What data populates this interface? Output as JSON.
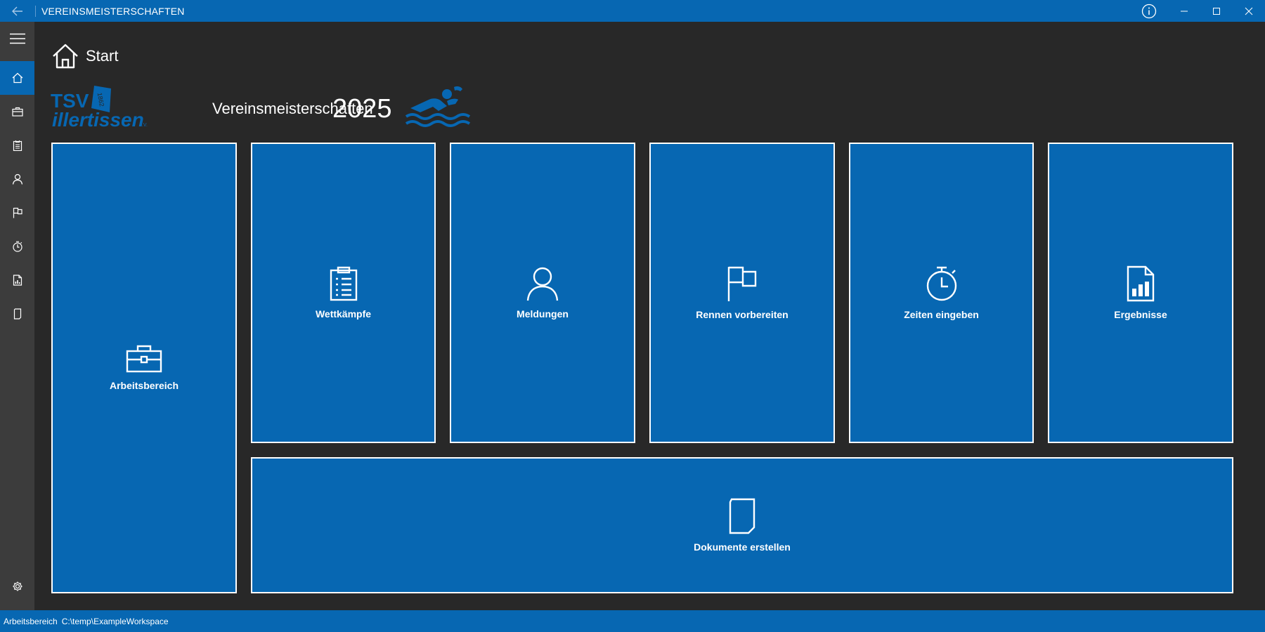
{
  "window": {
    "title": "VEREINSMEISTERSCHAFTEN",
    "back_icon": "back-arrow-icon",
    "info_icon": "info-icon",
    "minimize_icon": "minimize-icon",
    "maximize_icon": "maximize-icon",
    "close_icon": "close-icon"
  },
  "nav": {
    "items": [
      {
        "name": "hamburger-menu",
        "icon": "hamburger-icon"
      },
      {
        "name": "home",
        "icon": "home-icon",
        "active": true
      },
      {
        "name": "workspace",
        "icon": "briefcase-icon"
      },
      {
        "name": "competitions",
        "icon": "clipboard-icon"
      },
      {
        "name": "registrations",
        "icon": "person-icon"
      },
      {
        "name": "races",
        "icon": "flag-icon"
      },
      {
        "name": "times",
        "icon": "stopwatch-icon"
      },
      {
        "name": "results",
        "icon": "report-icon"
      },
      {
        "name": "documents",
        "icon": "document-icon"
      },
      {
        "name": "settings",
        "icon": "gear-icon"
      }
    ]
  },
  "header": {
    "title": "Start",
    "icon": "home-icon"
  },
  "brand": {
    "logo_text_line1": "TSV",
    "logo_text_line2": "illertissen",
    "logo_badge": "1862",
    "logo_suffix": "e.V.",
    "name": "Vereinsmeisterschaften",
    "year": "2025",
    "swimmer_icon": "swimmer-icon"
  },
  "tiles": {
    "workspace": {
      "label": "Arbeitsbereich",
      "icon": "briefcase-icon"
    },
    "competitions": {
      "label": "Wettkämpfe",
      "icon": "clipboard-icon"
    },
    "registrations": {
      "label": "Meldungen",
      "icon": "person-icon"
    },
    "prepare_races": {
      "label": "Rennen vorbereiten",
      "icon": "flag-icon"
    },
    "enter_times": {
      "label": "Zeiten eingeben",
      "icon": "stopwatch-icon"
    },
    "results": {
      "label": "Ergebnisse",
      "icon": "report-icon"
    },
    "create_documents": {
      "label": "Dokumente erstellen",
      "icon": "document-icon"
    }
  },
  "status": {
    "label": "Arbeitsbereich",
    "value": "C:\\temp\\ExampleWorkspace"
  },
  "colors": {
    "accent": "#0767b2",
    "background": "#282828",
    "nav_background": "#3c3c3c",
    "tile_border": "#ffffff"
  }
}
